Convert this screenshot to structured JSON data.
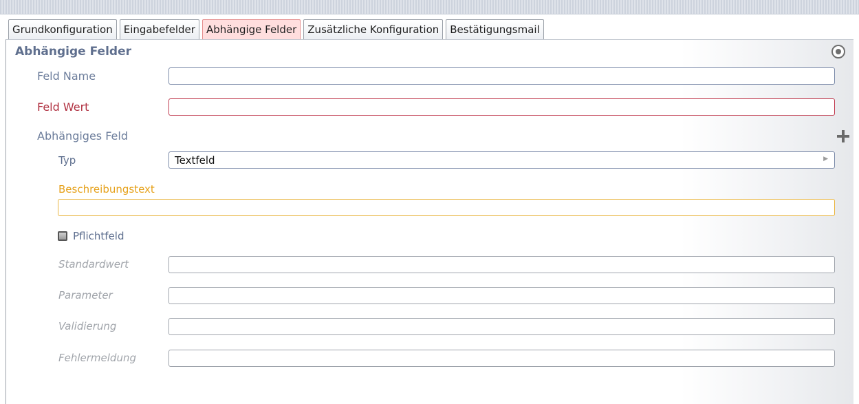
{
  "tabs": [
    {
      "label": "Grundkonfiguration",
      "active": false
    },
    {
      "label": "Eingabefelder",
      "active": false
    },
    {
      "label": "Abhängige Felder",
      "active": true
    },
    {
      "label": "Zusätzliche Konfiguration",
      "active": false
    },
    {
      "label": "Bestätigungsmail",
      "active": false
    }
  ],
  "section": {
    "title": "Abhängige Felder",
    "options_icon": "radio-circle-icon"
  },
  "fields": {
    "feld_name": {
      "label": "Feld Name",
      "value": ""
    },
    "feld_wert": {
      "label": "Feld Wert",
      "value": ""
    },
    "abhaengiges_feld": {
      "label": "Abhängiges Feld",
      "add_icon": "plus-icon"
    },
    "typ": {
      "label": "Typ",
      "selected": "Textfeld"
    },
    "beschreibungstext": {
      "label": "Beschreibungstext",
      "value": ""
    },
    "pflichtfeld": {
      "label": "Pflichtfeld",
      "checked": false
    },
    "standardwert": {
      "label": "Standardwert",
      "value": ""
    },
    "parameter": {
      "label": "Parameter",
      "value": ""
    },
    "validierung": {
      "label": "Validierung",
      "value": ""
    },
    "fehlermeldung": {
      "label": "Fehlermeldung",
      "value": ""
    }
  },
  "colors": {
    "active_tab": "#ffdede",
    "label_blue": "#6c7d9b",
    "error_red": "#b03040",
    "warning_orange": "#e6a11a",
    "muted_grey": "#a0a4aa"
  }
}
